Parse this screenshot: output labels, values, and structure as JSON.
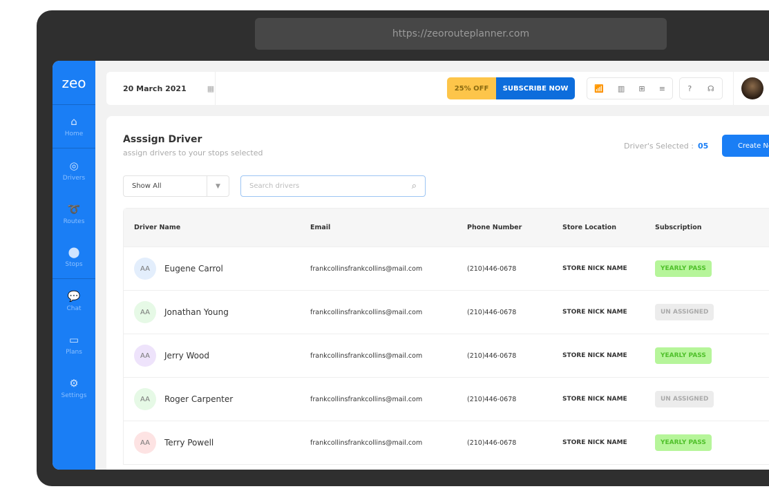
{
  "browser": {
    "url": "https://zeorouteplanner.com"
  },
  "sidebar": {
    "logo": "zeo",
    "items": [
      {
        "label": "Home",
        "icon": "home-icon"
      },
      {
        "label": "Drivers",
        "icon": "steering-wheel-icon"
      },
      {
        "label": "Routes",
        "icon": "route-icon"
      },
      {
        "label": "Stops",
        "icon": "map-pin-icon"
      },
      {
        "label": "Chat",
        "icon": "chat-icon"
      },
      {
        "label": "Plans",
        "icon": "ticket-icon"
      },
      {
        "label": "Settings",
        "icon": "gear-icon"
      }
    ]
  },
  "topbar": {
    "date": "20 March 2021",
    "discount": "25% OFF",
    "subscribe": "SUBSCRIBE NOW"
  },
  "page": {
    "title": "Asssign Driver",
    "subtitle": "assign drivers to your stops selected",
    "selected_label": "Driver's Selected :",
    "selected_count": "05",
    "create_button": "Create New",
    "filter_value": "Show All",
    "search_placeholder": "Search drivers"
  },
  "table": {
    "headers": [
      "Driver Name",
      "Email",
      "Phone Number",
      "Store Location",
      "Subscription"
    ],
    "rows": [
      {
        "initials": "AA",
        "name": "Eugene Carrol",
        "email": "frankcollinsfrankcollins@mail.com",
        "phone": "(210)446-0678",
        "store": "STORE NICK NAME",
        "subscription": "YEARLY PASS",
        "avatar_color": "#e3eefc"
      },
      {
        "initials": "AA",
        "name": "Jonathan Young",
        "email": "frankcollinsfrankcollins@mail.com",
        "phone": "(210)446-0678",
        "store": "STORE NICK NAME",
        "subscription": "UN ASSIGNED",
        "avatar_color": "#e6f9e6"
      },
      {
        "initials": "AA",
        "name": "Jerry Wood",
        "email": "frankcollinsfrankcollins@mail.com",
        "phone": "(210)446-0678",
        "store": "STORE NICK NAME",
        "subscription": "YEARLY PASS",
        "avatar_color": "#eee3fb"
      },
      {
        "initials": "AA",
        "name": "Roger Carpenter",
        "email": "frankcollinsfrankcollins@mail.com",
        "phone": "(210)446-0678",
        "store": "STORE NICK NAME",
        "subscription": "UN ASSIGNED",
        "avatar_color": "#e6f9e6"
      },
      {
        "initials": "AA",
        "name": "Terry Powell",
        "email": "frankcollinsfrankcollins@mail.com",
        "phone": "(210)446-0678",
        "store": "STORE NICK NAME",
        "subscription": "YEARLY PASS",
        "avatar_color": "#fde3e3"
      }
    ]
  }
}
